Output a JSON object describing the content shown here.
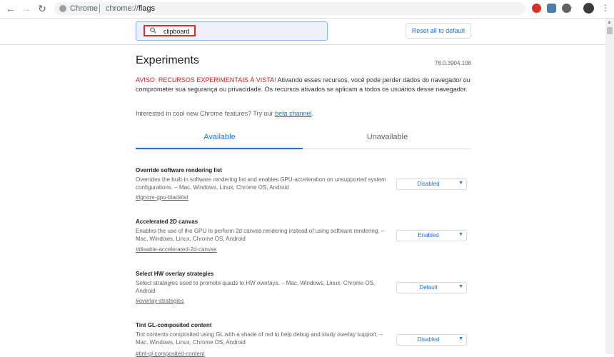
{
  "browser": {
    "site_label": "Chrome",
    "url_scheme": "chrome://",
    "url_path": "flags"
  },
  "search": {
    "query": "clipboard"
  },
  "toolbar": {
    "reset_label": "Reset all to default"
  },
  "main": {
    "title": "Experiments",
    "version": "78.0.3904.108",
    "warning_prefix": "AVISO: RECURSOS EXPERIMENTAIS À VISTA!",
    "warning_text": " Ativando esses recursos, você pode perder dados do navegador ou comprometer sua segurança ou privacidade. Os recursos ativados se aplicam a todos os usuários desse navegador.",
    "promo_text": "Interested in cool new Chrome features? Try our ",
    "promo_link": "beta channel",
    "promo_suffix": ".",
    "tabs": [
      {
        "label": "Available"
      },
      {
        "label": "Unavailable"
      }
    ]
  },
  "flags": [
    {
      "name": "Override software rendering list",
      "description": "Overrides the built-in software rendering list and enables GPU-acceleration on unsupported system configurations. – Mac, Windows, Linux, Chrome OS, Android",
      "link": "#ignore-gpu-blacklist",
      "value": "Disabled"
    },
    {
      "name": "Accelerated 2D canvas",
      "description": "Enables the use of the GPU to perform 2d canvas rendering instead of using software rendering. – Mac, Windows, Linux, Chrome OS, Android",
      "link": "#disable-accelerated-2d-canvas",
      "value": "Enabled"
    },
    {
      "name": "Select HW overlay strategies",
      "description": "Select strategies used to promote quads to HW overlays. – Mac, Windows, Linux, Chrome OS, Android",
      "link": "#overlay-strategies",
      "value": "Default"
    },
    {
      "name": "Tint GL-composited content",
      "description": "Tint contents composited using GL with a shade of red to help debug and study overlay support. – Mac, Windows, Linux, Chrome OS, Android",
      "link": "#tint-gl-composited-content",
      "value": "Disabled"
    }
  ],
  "colors": {
    "accent": "#1a73e8",
    "warning": "#c5221f",
    "search_highlight": "#d32f2f"
  }
}
